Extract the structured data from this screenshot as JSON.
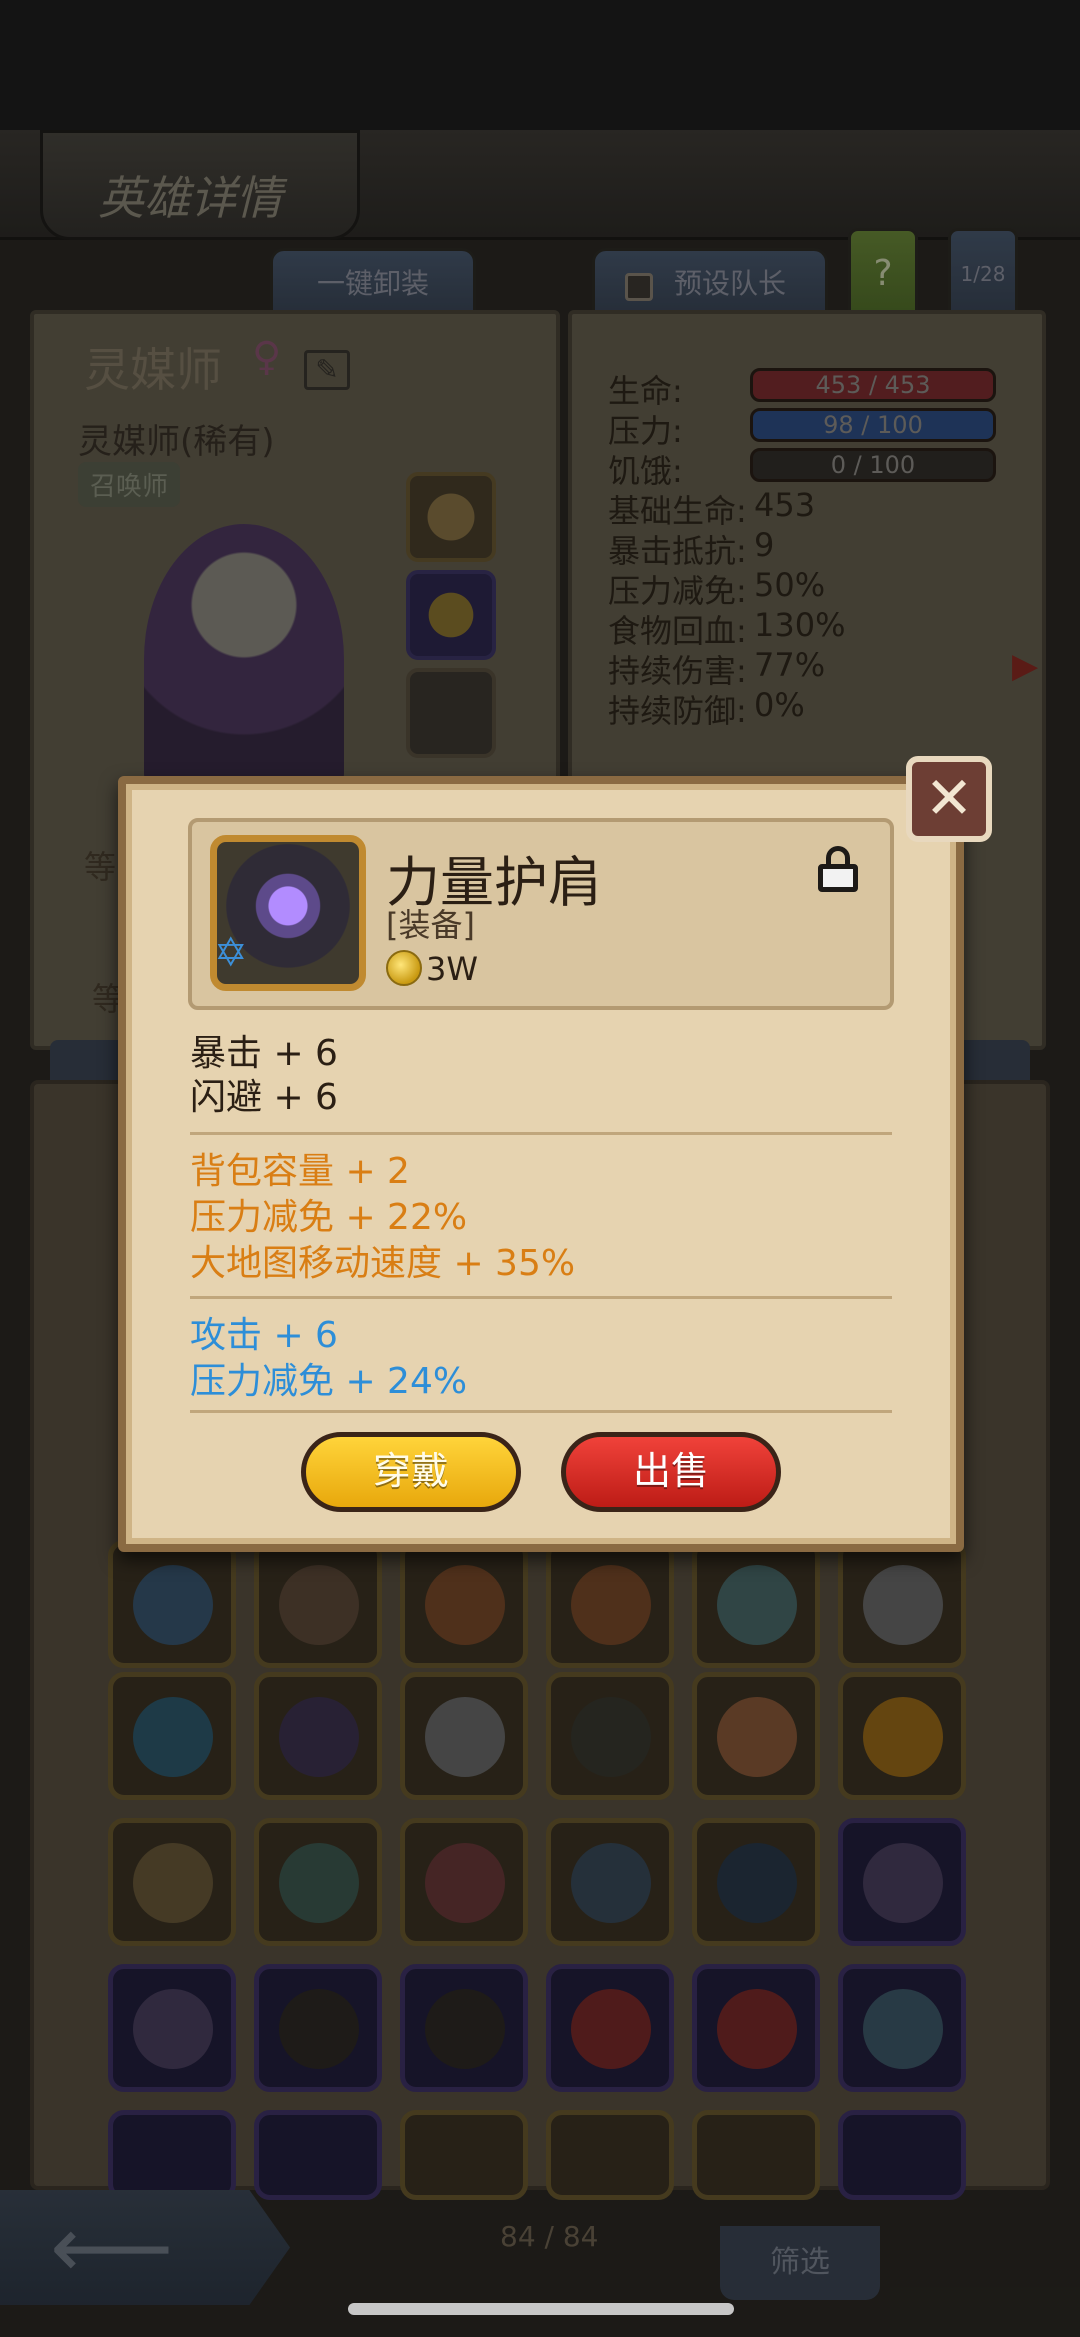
{
  "page": {
    "title": "英雄详情"
  },
  "tabs": {
    "unequip_all": "一键卸装",
    "preset_captain": "预设队长",
    "help": "?",
    "page_indicator": "1/28"
  },
  "hero": {
    "name": "灵媒师",
    "gender": "♀",
    "class": "灵媒师(稀有)",
    "role": "召唤师",
    "level_prefix": "等",
    "grade_prefix": "等"
  },
  "stats": {
    "hp": {
      "label": "生命:",
      "value": "453 / 453"
    },
    "stress": {
      "label": "压力:",
      "value": "98 / 100"
    },
    "hunger": {
      "label": "饥饿:",
      "value": "0 / 100"
    },
    "rows": [
      {
        "label": "基础生命:",
        "value": "453"
      },
      {
        "label": "暴击抵抗:",
        "value": "9"
      },
      {
        "label": "压力减免:",
        "value": "50%"
      },
      {
        "label": "食物回血:",
        "value": "130%"
      },
      {
        "label": "持续伤害:",
        "value": "77%"
      },
      {
        "label": "持续防御:",
        "value": "0%"
      }
    ]
  },
  "item": {
    "name": "力量护肩",
    "type": "[装备]",
    "price": "3W",
    "base_stats": [
      "暴击 + 6",
      "闪避 + 6"
    ],
    "bonus_stats": [
      "背包容量 + 2",
      "压力减免 + 22%",
      "大地图移动速度 + 35%"
    ],
    "enchant_stats": [
      "攻击 + 6",
      "压力减免 + 24%"
    ],
    "equip_label": "穿戴",
    "sell_label": "出售"
  },
  "inventory": {
    "count": "84 / 84",
    "filter_label": "筛选"
  },
  "colors": {
    "bonus": "#d97e14",
    "enchant": "#2d8ed8",
    "equip": "#f2b81c",
    "sell": "#d8281f"
  }
}
